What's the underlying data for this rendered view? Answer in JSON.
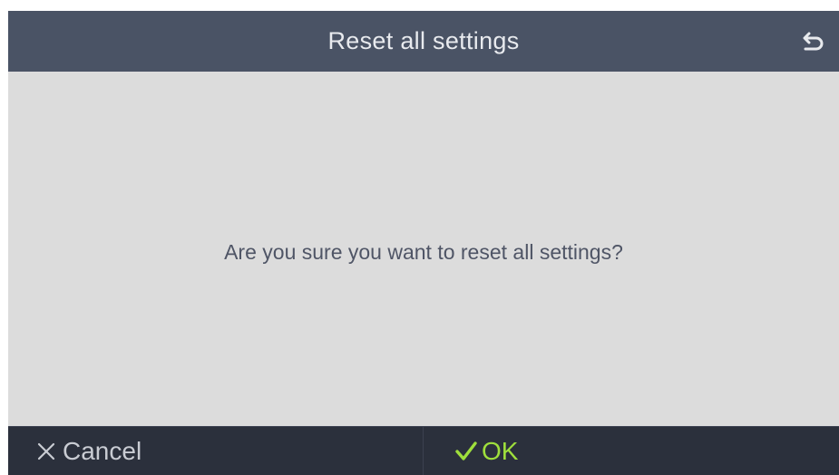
{
  "header": {
    "title": "Reset all settings",
    "back_icon": "back-arrow-icon"
  },
  "dialog": {
    "message": "Are you sure you want to reset all settings?"
  },
  "footer": {
    "cancel_label": "Cancel",
    "cancel_icon": "close-icon",
    "ok_label": "OK",
    "ok_icon": "checkmark-icon"
  },
  "colors": {
    "header_bg": "#4a5365",
    "content_bg": "#dcdcdc",
    "footer_bg": "#2b303c",
    "ok_accent": "#9fdf3c",
    "text_secondary": "#c9ccd3"
  }
}
